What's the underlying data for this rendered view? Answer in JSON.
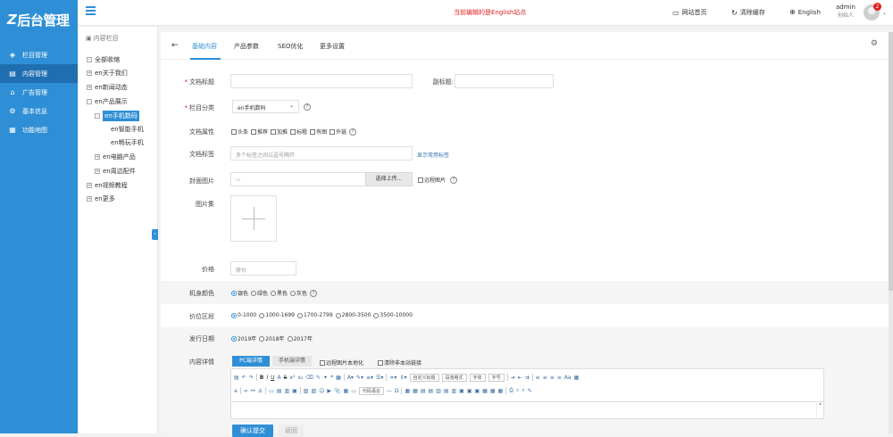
{
  "app": {
    "logo_mark": "Z",
    "logo_text": "后台管理"
  },
  "sidebar": {
    "items": [
      {
        "label": "栏目管理",
        "icon": "layers-icon"
      },
      {
        "label": "内容管理",
        "icon": "document-icon"
      },
      {
        "label": "广告管理",
        "icon": "home-icon"
      },
      {
        "label": "基本信息",
        "icon": "settings-icon"
      },
      {
        "label": "功能地图",
        "icon": "grid-icon"
      }
    ],
    "active_index": 1
  },
  "topbar": {
    "notice": "当前编辑的是English站点",
    "site_home": "网站首页",
    "clear_cache": "清除缓存",
    "language": "English",
    "user": "admin",
    "role": "创始人",
    "badge_count": "2"
  },
  "tree": {
    "title": "内容栏目",
    "nodes": [
      {
        "label": "全部收缩",
        "box": "-"
      },
      {
        "label": "en关于我们",
        "box": "+"
      },
      {
        "label": "en新闻动态",
        "box": "+"
      },
      {
        "label": "en产品展示",
        "box": "-"
      },
      {
        "label": "en手机数码",
        "box": "-"
      },
      {
        "label": "en智能手机",
        "box": ""
      },
      {
        "label": "en畅玩手机",
        "box": ""
      },
      {
        "label": "en电脑产品",
        "box": "+"
      },
      {
        "label": "en周边配件",
        "box": "+"
      },
      {
        "label": "en视频教程",
        "box": "+"
      },
      {
        "label": "en更多",
        "box": "+"
      }
    ]
  },
  "tabs": [
    "基础内容",
    "产品参数",
    "SEO优化",
    "更多设置"
  ],
  "form": {
    "title_label": "文档标题",
    "subtitle_label": "副标题:",
    "category_label": "栏目分类",
    "category_value": "en手机数码",
    "attr_label": "文档属性",
    "attrs": [
      "头条",
      "推荐",
      "加推",
      "标粗",
      "有图",
      "外链"
    ],
    "tags_label": "文档标签",
    "tags_placeholder": "多个标签之间以逗号隔开",
    "tags_link": "显示常用标签",
    "cover_label": "封面图片",
    "upload_btn": "选择上传...",
    "remote_image": "远程图片",
    "gallery_label": "图片集",
    "price_label": "价格",
    "price_placeholder": "原价",
    "color_label": "机身颜色",
    "colors": [
      "银色",
      "绿色",
      "黑色",
      "灰色"
    ],
    "range_label": "价位区段",
    "ranges": [
      "0-1000",
      "1000-1699",
      "1700-2799",
      "2800-3500",
      "3500-10000"
    ],
    "date_label": "发行日期",
    "dates": [
      "2019年",
      "2018年",
      "2017年"
    ],
    "detail_label": "内容详情",
    "pc_tab": "PC端详情",
    "mobile_tab": "手机端详情",
    "localize_images": "远程图片本地化",
    "remove_links": "清除非本站链接",
    "editor": {
      "paragraph_format": "段落格式",
      "custom_heading": "自定义标题",
      "font_family": "字体",
      "font_size": "字号",
      "code_lang": "代码语言"
    },
    "submit": "确认提交",
    "back": "返回"
  }
}
